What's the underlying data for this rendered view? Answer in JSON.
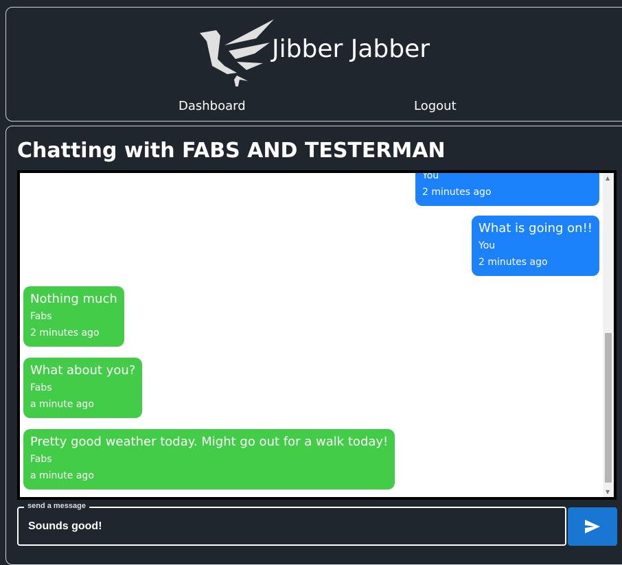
{
  "header": {
    "title": "Jibber Jabber",
    "nav": [
      {
        "label": "Dashboard"
      },
      {
        "label": "Logout"
      }
    ]
  },
  "chat": {
    "title": "Chatting with FABS AND TESTERMAN",
    "messages": [
      {
        "text": "",
        "author": "You",
        "time": "2 minutes ago",
        "side": "right"
      },
      {
        "text": "What is going on!!",
        "author": "You",
        "time": "2 minutes ago",
        "side": "right"
      },
      {
        "text": "Nothing much",
        "author": "Fabs",
        "time": "2 minutes ago",
        "side": "left"
      },
      {
        "text": "What about you?",
        "author": "Fabs",
        "time": "a minute ago",
        "side": "left"
      },
      {
        "text": "Pretty good weather today. Might go out for a walk today!",
        "author": "Fabs",
        "time": "a minute ago",
        "side": "left"
      }
    ],
    "colors": {
      "own": "#1b82fb",
      "other": "#42cc48"
    }
  },
  "composer": {
    "legend": "send a message",
    "value": "Sounds good!",
    "send_icon": "send-icon"
  }
}
